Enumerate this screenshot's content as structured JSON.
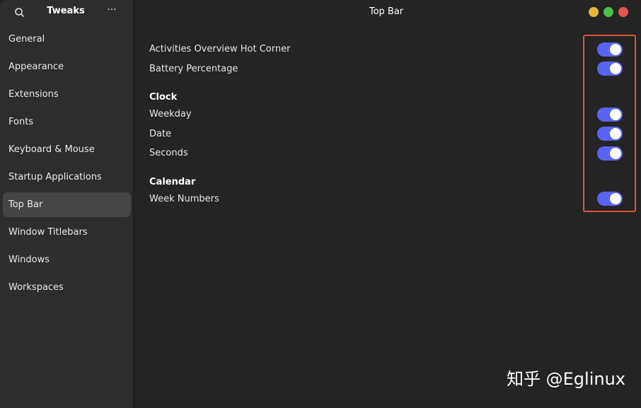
{
  "sidebar": {
    "title": "Tweaks",
    "menu_label": "···",
    "items": [
      {
        "label": "General",
        "active": false
      },
      {
        "label": "Appearance",
        "active": false
      },
      {
        "label": "Extensions",
        "active": false
      },
      {
        "label": "Fonts",
        "active": false
      },
      {
        "label": "Keyboard & Mouse",
        "active": false
      },
      {
        "label": "Startup Applications",
        "active": false
      },
      {
        "label": "Top Bar",
        "active": true
      },
      {
        "label": "Window Titlebars",
        "active": false
      },
      {
        "label": "Windows",
        "active": false
      },
      {
        "label": "Workspaces",
        "active": false
      }
    ]
  },
  "main": {
    "title": "Top Bar",
    "settings": {
      "hot_corner": {
        "label": "Activities Overview Hot Corner",
        "on": true
      },
      "battery": {
        "label": "Battery Percentage",
        "on": true
      },
      "clock_heading": "Clock",
      "weekday": {
        "label": "Weekday",
        "on": true
      },
      "date": {
        "label": "Date",
        "on": true
      },
      "seconds": {
        "label": "Seconds",
        "on": true
      },
      "calendar_heading": "Calendar",
      "week_numbers": {
        "label": "Week Numbers",
        "on": true
      }
    }
  },
  "watermark": "知乎 @Eglinux",
  "colors": {
    "toggle_on": "#5865f2",
    "highlight": "#d4563a",
    "close": "#e7544e",
    "minimize": "#e9b53a",
    "maximize": "#4bc04a"
  },
  "icons": {
    "search": "search-icon",
    "menu": "more-horizontal-icon"
  }
}
